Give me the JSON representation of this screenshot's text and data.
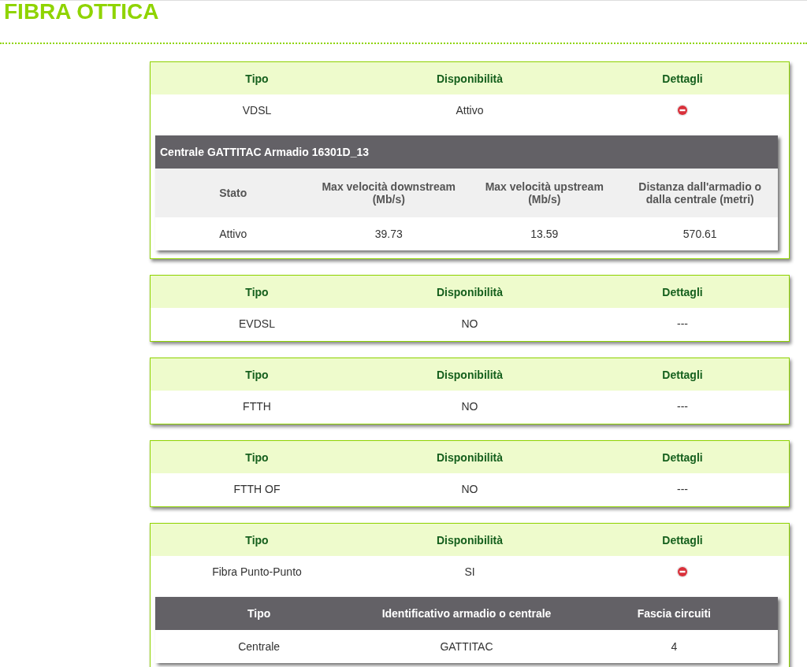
{
  "title": "FIBRA OTTICA",
  "cards": [
    {
      "columns": [
        "Tipo",
        "Disponibilità",
        "Dettagli"
      ],
      "row": {
        "tipo": "VDSL",
        "disponibilita": "Attivo",
        "expanded": true
      },
      "details": {
        "kind": "titled",
        "title": "Centrale GATTITAC Armadio 16301D_13",
        "columns": [
          "Stato",
          "Max velocità downstream (Mb/s)",
          "Max velocità upstream (Mb/s)",
          "Distanza dall'armadio o dalla centrale (metri)"
        ],
        "rows": [
          [
            "Attivo",
            "39.73",
            "13.59",
            "570.61"
          ]
        ]
      }
    },
    {
      "columns": [
        "Tipo",
        "Disponibilità",
        "Dettagli"
      ],
      "row": {
        "tipo": "EVDSL",
        "disponibilita": "NO",
        "dettagli": "---"
      }
    },
    {
      "columns": [
        "Tipo",
        "Disponibilità",
        "Dettagli"
      ],
      "row": {
        "tipo": "FTTH",
        "disponibilita": "NO",
        "dettagli": "---"
      }
    },
    {
      "columns": [
        "Tipo",
        "Disponibilità",
        "Dettagli"
      ],
      "row": {
        "tipo": "FTTH OF",
        "disponibilita": "NO",
        "dettagli": "---"
      }
    },
    {
      "columns": [
        "Tipo",
        "Disponibilità",
        "Dettagli"
      ],
      "row": {
        "tipo": "Fibra Punto-Punto",
        "disponibilita": "SI",
        "expanded": true
      },
      "details": {
        "kind": "plain",
        "columns": [
          "Tipo",
          "Identificativo armadio o centrale",
          "Fascia circuiti"
        ],
        "rows": [
          [
            "Centrale",
            "GATTITAC",
            "4"
          ]
        ]
      }
    }
  ]
}
